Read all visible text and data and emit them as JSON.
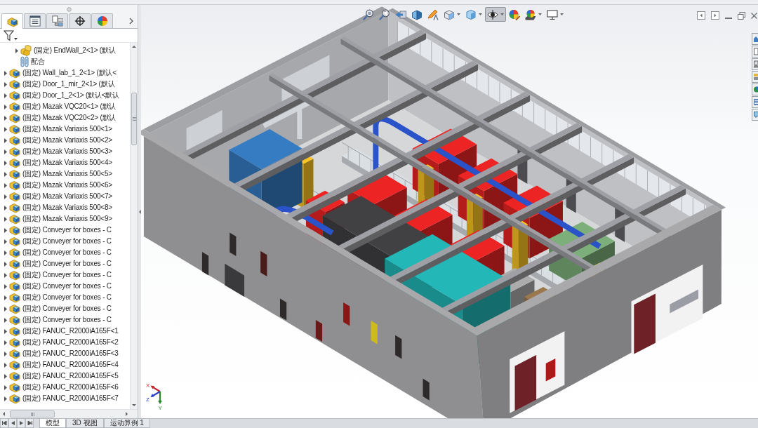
{
  "panel_tabs": [
    {
      "kind": "tree",
      "selected": true
    },
    {
      "kind": "properties",
      "selected": false
    },
    {
      "kind": "configurations",
      "selected": false
    },
    {
      "kind": "dimensions",
      "selected": false
    },
    {
      "kind": "display",
      "selected": false
    }
  ],
  "tree": {
    "nested_items": [
      {
        "kind": "assembly",
        "label": "(固定) EndWall_2<1> (默认",
        "expanded": false
      },
      {
        "kind": "mates",
        "label": "配合"
      }
    ],
    "items": [
      {
        "kind": "part",
        "label": "(固定) Wall_lab_1_2<1> (默认<",
        "expanded": false
      },
      {
        "kind": "part",
        "label": "(固定) Door_1_mir_2<1> (默认",
        "expanded": false
      },
      {
        "kind": "part",
        "label": "(固定) Door_1_2<1> (默认<默认",
        "expanded": false
      },
      {
        "kind": "part",
        "label": "(固定) Mazak VQC20<1> (默认",
        "expanded": false
      },
      {
        "kind": "part",
        "label": "(固定) Mazak VQC20<2> (默认",
        "expanded": false
      },
      {
        "kind": "part",
        "label": "(固定) Mazak Variaxis 500<1>",
        "expanded": false
      },
      {
        "kind": "part",
        "label": "(固定) Mazak Variaxis 500<2>",
        "expanded": false
      },
      {
        "kind": "part",
        "label": "(固定) Mazak Variaxis 500<3>",
        "expanded": false
      },
      {
        "kind": "part",
        "label": "(固定) Mazak Variaxis 500<4>",
        "expanded": false
      },
      {
        "kind": "part",
        "label": "(固定) Mazak Variaxis 500<5>",
        "expanded": false
      },
      {
        "kind": "part",
        "label": "(固定) Mazak Variaxis 500<6>",
        "expanded": false
      },
      {
        "kind": "part",
        "label": "(固定) Mazak Variaxis 500<7>",
        "expanded": false
      },
      {
        "kind": "part",
        "label": "(固定) Mazak Variaxis 500<8>",
        "expanded": false
      },
      {
        "kind": "part",
        "label": "(固定) Mazak Variaxis 500<9>",
        "expanded": false
      },
      {
        "kind": "part",
        "label": "(固定) Conveyer for boxes - C",
        "expanded": false
      },
      {
        "kind": "part",
        "label": "(固定) Conveyer for boxes - C",
        "expanded": false
      },
      {
        "kind": "part",
        "label": "(固定) Conveyer for boxes - C",
        "expanded": false
      },
      {
        "kind": "part",
        "label": "(固定) Conveyer for boxes - C",
        "expanded": false
      },
      {
        "kind": "part",
        "label": "(固定) Conveyer for boxes - C",
        "expanded": false
      },
      {
        "kind": "part",
        "label": "(固定) Conveyer for boxes - C",
        "expanded": false
      },
      {
        "kind": "part",
        "label": "(固定) Conveyer for boxes - C",
        "expanded": false
      },
      {
        "kind": "part",
        "label": "(固定) Conveyer for boxes - C",
        "expanded": false
      },
      {
        "kind": "part",
        "label": "(固定) Conveyer for boxes - C",
        "expanded": false
      },
      {
        "kind": "part",
        "label": "(固定) FANUC_R2000iA165F<1",
        "expanded": false
      },
      {
        "kind": "part",
        "label": "(固定) FANUC_R2000iA165F<2",
        "expanded": false
      },
      {
        "kind": "part",
        "label": "(固定) FANUC_R2000iA165F<3",
        "expanded": false
      },
      {
        "kind": "part",
        "label": "(固定) FANUC_R2000iA165F<4",
        "expanded": false
      },
      {
        "kind": "part",
        "label": "(固定) FANUC_R2000iA165F<5",
        "expanded": false
      },
      {
        "kind": "part",
        "label": "(固定) FANUC_R2000iA165F<6",
        "expanded": false
      },
      {
        "kind": "part",
        "label": "(固定) FANUC_R2000iA165F<7",
        "expanded": false
      }
    ]
  },
  "view_toolbar": [
    {
      "kind": "zoomfit",
      "dropdown": false,
      "pressed": false
    },
    {
      "kind": "zoomarea",
      "dropdown": false,
      "pressed": false
    },
    {
      "kind": "previous",
      "dropdown": false,
      "pressed": false
    },
    {
      "kind": "section",
      "dropdown": false,
      "pressed": false
    },
    {
      "kind": "annotation",
      "dropdown": false,
      "pressed": false
    },
    {
      "kind": "orientation",
      "dropdown": true,
      "pressed": false
    },
    {
      "kind": "style",
      "dropdown": true,
      "pressed": false
    },
    {
      "kind": "visibility",
      "dropdown": true,
      "pressed": true
    },
    {
      "kind": "appearance",
      "dropdown": false,
      "pressed": false
    },
    {
      "kind": "scene",
      "dropdown": true,
      "pressed": false
    },
    {
      "kind": "settings",
      "dropdown": true,
      "pressed": false
    }
  ],
  "triad": {
    "x_label": "X",
    "y_label": "Y",
    "z_label": "Z"
  },
  "bottom_tabs": [
    {
      "label": "模型",
      "selected": true
    },
    {
      "label": "3D 视图",
      "selected": false
    },
    {
      "label": "运动算例 1",
      "selected": false
    }
  ]
}
